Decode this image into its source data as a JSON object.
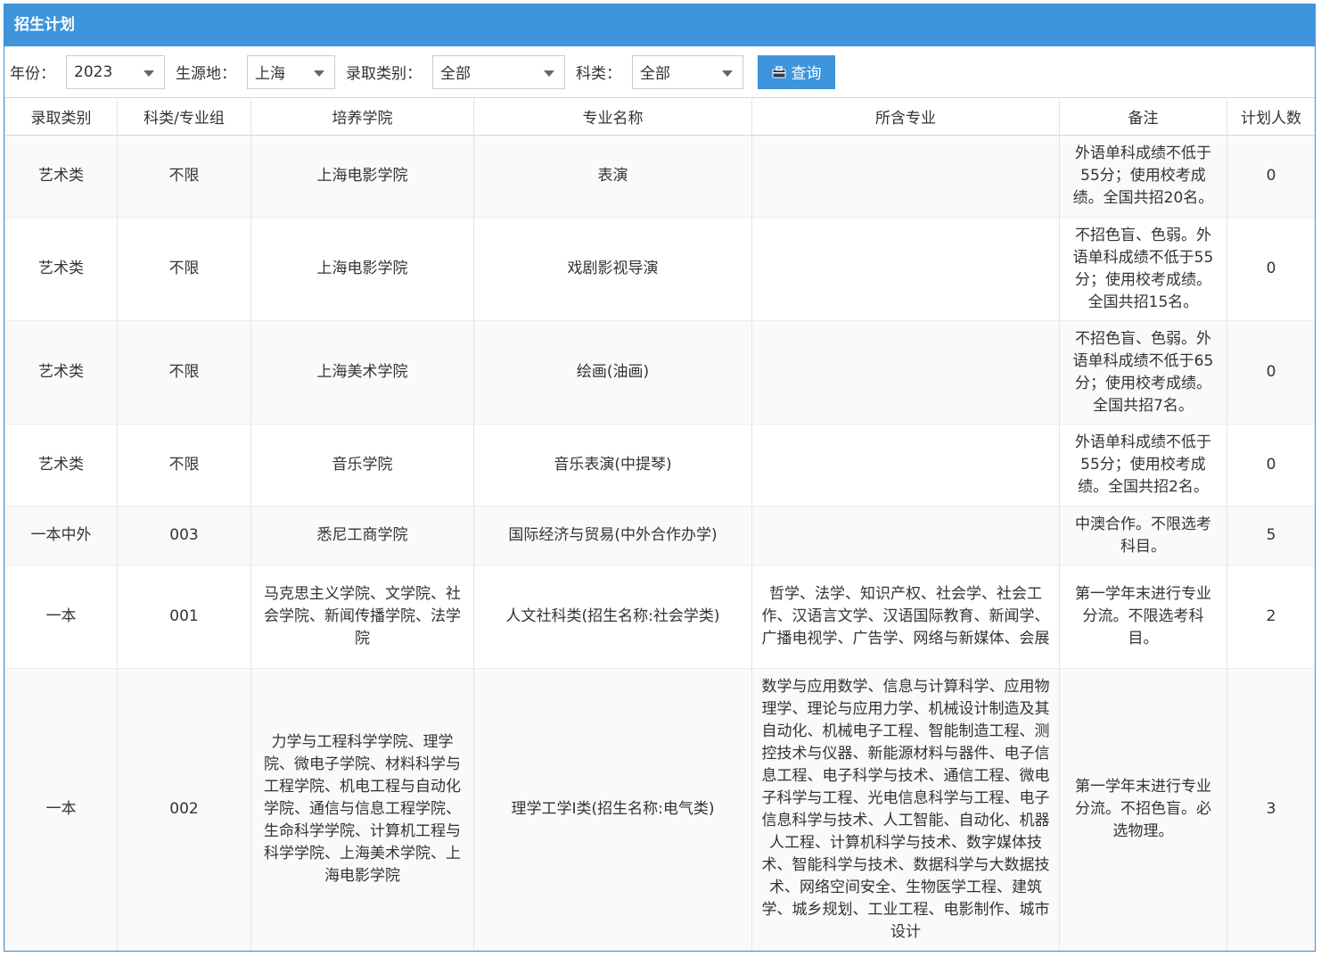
{
  "panel": {
    "title": "招生计划"
  },
  "filters": {
    "year": {
      "label": "年份：",
      "value": "2023"
    },
    "source": {
      "label": "生源地：",
      "value": "上海"
    },
    "admission_type": {
      "label": "录取类别：",
      "value": "全部"
    },
    "subject": {
      "label": "科类：",
      "value": "全部"
    },
    "query_button": {
      "label": "查询",
      "icon": "toolbox-icon"
    }
  },
  "table": {
    "headers": [
      "录取类别",
      "科类/专业组",
      "培养学院",
      "专业名称",
      "所含专业",
      "备注",
      "计划人数"
    ],
    "rows": [
      [
        "艺术类",
        "不限",
        "上海电影学院",
        "表演",
        "",
        "外语单科成绩不低于55分；使用校考成绩。全国共招20名。",
        "0"
      ],
      [
        "艺术类",
        "不限",
        "上海电影学院",
        "戏剧影视导演",
        "",
        "不招色盲、色弱。外语单科成绩不低于55分；使用校考成绩。全国共招15名。",
        "0"
      ],
      [
        "艺术类",
        "不限",
        "上海美术学院",
        "绘画(油画)",
        "",
        "不招色盲、色弱。外语单科成绩不低于65分；使用校考成绩。全国共招7名。",
        "0"
      ],
      [
        "艺术类",
        "不限",
        "音乐学院",
        "音乐表演(中提琴)",
        "",
        "外语单科成绩不低于55分；使用校考成绩。全国共招2名。",
        "0"
      ],
      [
        "一本中外",
        "003",
        "悉尼工商学院",
        "国际经济与贸易(中外合作办学)",
        "",
        "中澳合作。不限选考科目。",
        "5"
      ],
      [
        "一本",
        "001",
        "马克思主义学院、文学院、社会学院、新闻传播学院、法学院",
        "人文社科类(招生名称:社会学类)",
        "哲学、法学、知识产权、社会学、社会工作、汉语言文学、汉语国际教育、新闻学、广播电视学、广告学、网络与新媒体、会展",
        "第一学年末进行专业分流。不限选考科目。",
        "2"
      ],
      [
        "一本",
        "002",
        "力学与工程科学学院、理学院、微电子学院、材料科学与工程学院、机电工程与自动化学院、通信与信息工程学院、生命科学学院、计算机工程与科学学院、上海美术学院、上海电影学院",
        "理学工学I类(招生名称:电气类)",
        "数学与应用数学、信息与计算科学、应用物理学、理论与应用力学、机械设计制造及其自动化、机械电子工程、智能制造工程、测控技术与仪器、新能源材料与器件、电子信息工程、电子科学与技术、通信工程、微电子科学与工程、光电信息科学与工程、电子信息科学与技术、人工智能、自动化、机器人工程、计算机科学与技术、数字媒体技术、智能科学与技术、数据科学与大数据技术、网络空间安全、生物医学工程、建筑学、城乡规划、工业工程、电影制作、城市设计",
        "第一学年末进行专业分流。不招色盲。必选物理。",
        "3"
      ]
    ]
  }
}
